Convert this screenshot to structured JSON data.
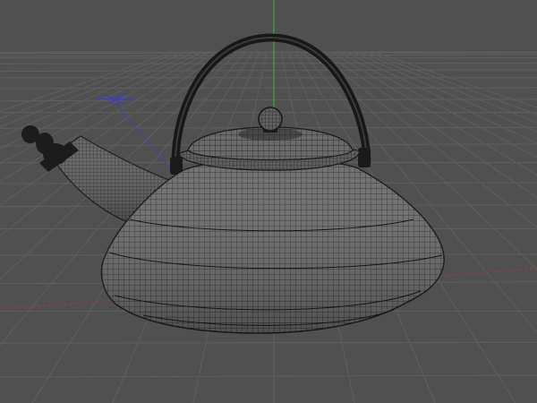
{
  "viewport": {
    "mode": "wireframe",
    "background": "#505050",
    "grid_color": "#5c5c5c",
    "wire_color": "#1e1e1e",
    "axis_colors": {
      "x": "#c83232",
      "y": "#2fc02f",
      "z": "#3a3ad8"
    }
  },
  "scene": {
    "object": "teapot",
    "parts": [
      "teapot-body",
      "teapot-spout",
      "teapot-lid",
      "teapot-handle",
      "lid-knob",
      "spout-cap"
    ]
  }
}
